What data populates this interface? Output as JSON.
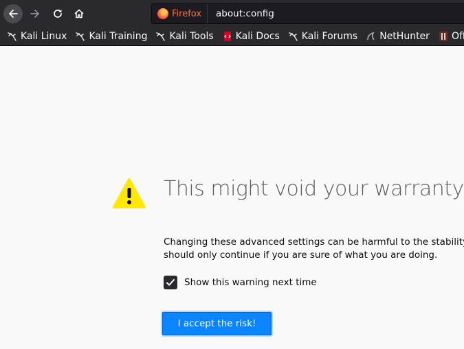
{
  "browser": {
    "identity_label": "Firefox",
    "url": "about:config",
    "icons": {
      "back": "back-arrow-icon",
      "forward": "forward-arrow-icon",
      "reload": "reload-icon",
      "home": "home-icon"
    },
    "colors": {
      "toolbar": "#2a2a2e",
      "identity": "#ff6f3a"
    }
  },
  "bookmarks": [
    {
      "label": "Kali Linux",
      "icon": "kali-dragon-icon"
    },
    {
      "label": "Kali Training",
      "icon": "kali-dragon-icon"
    },
    {
      "label": "Kali Tools",
      "icon": "kali-dragon-icon"
    },
    {
      "label": "Kali Docs",
      "icon": "kali-docs-icon"
    },
    {
      "label": "Kali Forums",
      "icon": "kali-dragon-icon"
    },
    {
      "label": "NetHunter",
      "icon": "nethunter-icon"
    },
    {
      "label": "Offensive Security",
      "icon": "offsec-icon"
    }
  ],
  "warning": {
    "icon": "warning-triangle-icon",
    "title": "This might void your warranty!",
    "description": "Changing these advanced settings can be harmful to the stability, security, and performance of this application. You\nshould only continue if you are sure of what you are doing.",
    "checkbox_label": "Show this warning next time",
    "checkbox_checked": true,
    "accept_button": "I accept the risk!",
    "colors": {
      "icon": "#ffe900",
      "accent": "#0a84ff"
    }
  }
}
